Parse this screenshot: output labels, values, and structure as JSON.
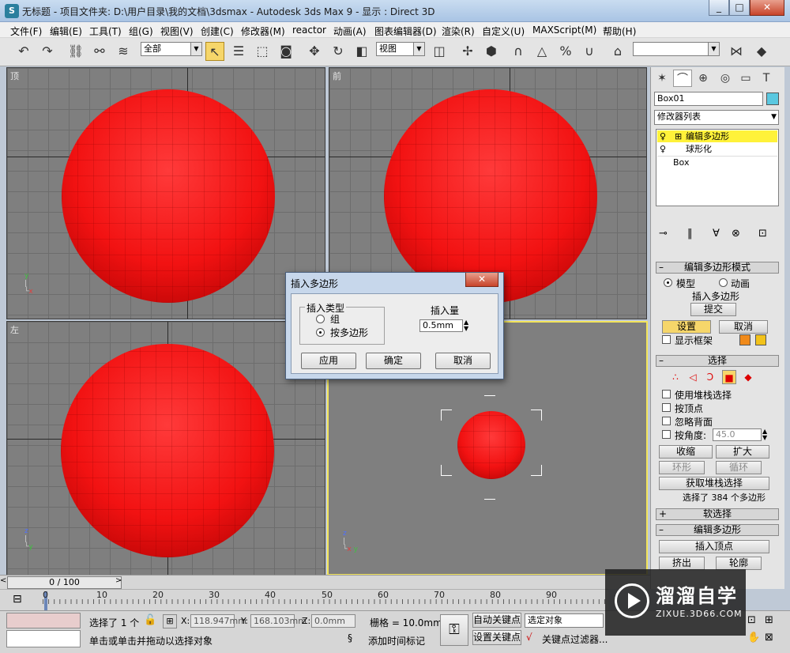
{
  "window": {
    "title": "无标题      - 项目文件夹: D:\\用户目录\\我的文档\\3dsmax     - Autodesk 3ds Max 9      - 显示 : Direct 3D",
    "icon": "3ds-max-icon"
  },
  "menu": [
    "文件(F)",
    "编辑(E)",
    "工具(T)",
    "组(G)",
    "视图(V)",
    "创建(C)",
    "修改器(M)",
    "reactor",
    "动画(A)",
    "图表编辑器(D)",
    "渲染(R)",
    "自定义(U)",
    "MAXScript(M)",
    "帮助(H)"
  ],
  "toolbar": {
    "selection_filter": "全部",
    "reference_coord": "视图",
    "named_selection": ""
  },
  "viewports": {
    "top": "顶",
    "front": "前",
    "left": "左",
    "perspective": ""
  },
  "command_panel": {
    "object_name": "Box01",
    "object_color": "#5ac8e0",
    "modifier_list": "修改器列表",
    "stack": [
      "编辑多边形",
      "球形化",
      "Box"
    ],
    "rollout_mode": {
      "title": "编辑多边形模式",
      "radio_model": "模型",
      "radio_anim": "动画",
      "current_op": "插入多边形",
      "commit": "提交",
      "settings": "设置",
      "cancel": "取消",
      "show_cage": "显示框架",
      "cage_color1": "#f08a1a",
      "cage_color2": "#f2c21a"
    },
    "rollout_select": {
      "title": "选择",
      "use_stack": "使用堆栈选择",
      "by_vertex": "按顶点",
      "ignore_backface": "忽略背面",
      "by_angle": "按角度:",
      "angle_value": "45.0",
      "shrink": "收缩",
      "grow": "扩大",
      "ring": "环形",
      "loop": "循环",
      "get_stack": "获取堆栈选择",
      "status": "选择了 384 个多边形"
    },
    "rollout_soft": {
      "title": "软选择"
    },
    "rollout_edit": {
      "title": "编辑多边形",
      "insert_vertex": "插入顶点",
      "extrude": "挤出",
      "outline": "轮廓"
    }
  },
  "dialog": {
    "title": "插入多边形",
    "group_title": "插入类型",
    "opt_group": "组",
    "opt_by_poly": "按多边形",
    "amount_label": "插入量",
    "amount_value": "0.5mm",
    "apply": "应用",
    "ok": "确定",
    "cancel": "取消"
  },
  "timeline": {
    "frame": "0 / 100",
    "ticks": [
      "0",
      "10",
      "20",
      "30",
      "40",
      "50",
      "60",
      "70",
      "80",
      "90"
    ]
  },
  "status": {
    "selected": "选择了 1 个",
    "x_label": "X:",
    "x_value": "118.947mm",
    "y_label": "Y:",
    "y_value": "168.103mm",
    "z_label": "Z:",
    "z_value": "0.0mm",
    "grid": "栅格 = 10.0mm",
    "auto_key": "自动关键点",
    "set_key": "设置关键点",
    "key_mode": "选定对象",
    "key_filters": "关键点过滤器...",
    "prompt": "单击或单击并拖动以选择对象",
    "add_time_tag": "添加时间标记"
  },
  "watermark": {
    "name": "溜溜自学",
    "url": "ZIXUE.3D66.COM"
  }
}
